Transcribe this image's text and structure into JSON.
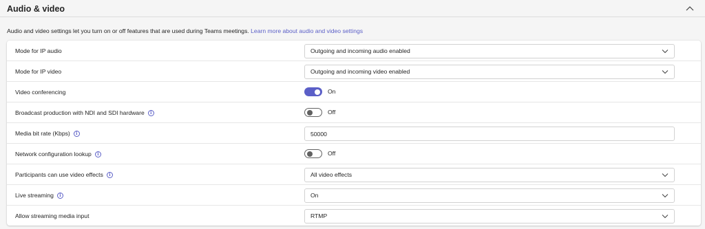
{
  "section": {
    "title": "Audio & video",
    "description": "Audio and video settings let you turn on or off features that are used during Teams meetings.",
    "learn_more": "Learn more about audio and video settings",
    "accent_color": "#5b5fc7"
  },
  "settings": [
    {
      "label": "Mode for IP audio",
      "control": "dropdown",
      "value": "Outgoing and incoming audio enabled",
      "info": false
    },
    {
      "label": "Mode for IP video",
      "control": "dropdown",
      "value": "Outgoing and incoming video enabled",
      "info": false
    },
    {
      "label": "Video conferencing",
      "control": "toggle",
      "state": true,
      "value": "On",
      "info": false
    },
    {
      "label": "Broadcast production with NDI and SDI hardware",
      "control": "toggle",
      "state": false,
      "value": "Off",
      "info": true
    },
    {
      "label": "Media bit rate (Kbps)",
      "control": "text",
      "value": "50000",
      "info": true
    },
    {
      "label": "Network configuration lookup",
      "control": "toggle",
      "state": false,
      "value": "Off",
      "info": true
    },
    {
      "label": "Participants can use video effects",
      "control": "dropdown",
      "value": "All video effects",
      "info": true
    },
    {
      "label": "Live streaming",
      "control": "dropdown",
      "value": "On",
      "info": true
    },
    {
      "label": "Allow streaming media input",
      "control": "dropdown",
      "value": "RTMP",
      "info": false
    }
  ]
}
